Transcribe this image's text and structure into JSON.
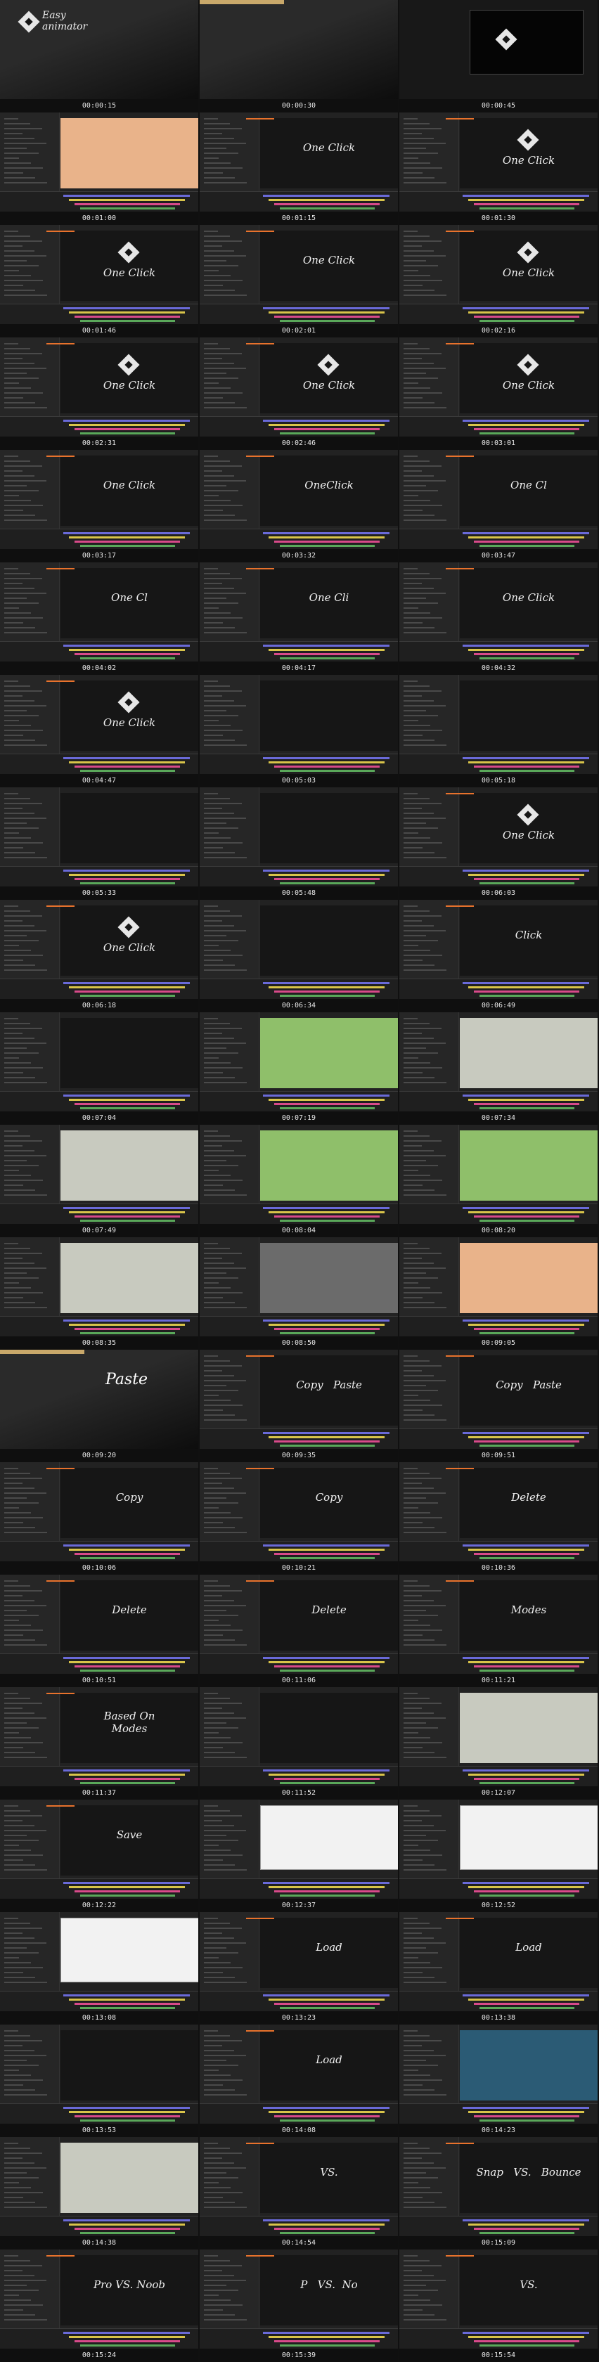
{
  "cells": [
    {
      "time": "00:00:15",
      "scene": "intro",
      "overlay": "Easy\nanimator"
    },
    {
      "time": "00:00:30",
      "scene": "intro3d",
      "overlay": ""
    },
    {
      "time": "00:00:45",
      "scene": "introsmall",
      "overlay": ""
    },
    {
      "time": "00:01:00",
      "scene": "room",
      "overlay": ""
    },
    {
      "time": "00:01:15",
      "scene": "ae",
      "overlay": "One Click"
    },
    {
      "time": "00:01:30",
      "scene": "ae-logo",
      "overlay": "One Click"
    },
    {
      "time": "00:01:46",
      "scene": "ae-logo",
      "overlay": "One Click"
    },
    {
      "time": "00:02:01",
      "scene": "ae",
      "overlay": "One Click"
    },
    {
      "time": "00:02:16",
      "scene": "ae-logo",
      "overlay": "One Click"
    },
    {
      "time": "00:02:31",
      "scene": "ae-logo",
      "overlay": "One Click"
    },
    {
      "time": "00:02:46",
      "scene": "ae-logo",
      "overlay": "One Click"
    },
    {
      "time": "00:03:01",
      "scene": "ae-logo",
      "overlay": "One Click"
    },
    {
      "time": "00:03:17",
      "scene": "ae",
      "overlay": "One Click"
    },
    {
      "time": "00:03:32",
      "scene": "ae",
      "overlay": "OneClick"
    },
    {
      "time": "00:03:47",
      "scene": "ae",
      "overlay": "One Cl"
    },
    {
      "time": "00:04:02",
      "scene": "ae",
      "overlay": "One Cl"
    },
    {
      "time": "00:04:17",
      "scene": "ae",
      "overlay": "One Cli"
    },
    {
      "time": "00:04:32",
      "scene": "ae",
      "overlay": "One Click"
    },
    {
      "time": "00:04:47",
      "scene": "ae-logo",
      "overlay": "One Click"
    },
    {
      "time": "00:05:03",
      "scene": "ae",
      "overlay": ""
    },
    {
      "time": "00:05:18",
      "scene": "ae",
      "overlay": ""
    },
    {
      "time": "00:05:33",
      "scene": "ae",
      "overlay": ""
    },
    {
      "time": "00:05:48",
      "scene": "ae",
      "overlay": ""
    },
    {
      "time": "00:06:03",
      "scene": "ae-logo",
      "overlay": "One Click"
    },
    {
      "time": "00:06:18",
      "scene": "ae-logo",
      "overlay": "One Click"
    },
    {
      "time": "00:06:34",
      "scene": "ae",
      "overlay": ""
    },
    {
      "time": "00:06:49",
      "scene": "ae",
      "overlay": "Click"
    },
    {
      "time": "00:07:04",
      "scene": "ae",
      "overlay": ""
    },
    {
      "time": "00:07:19",
      "scene": "city",
      "overlay": ""
    },
    {
      "time": "00:07:34",
      "scene": "map",
      "overlay": ""
    },
    {
      "time": "00:07:49",
      "scene": "map",
      "overlay": ""
    },
    {
      "time": "00:08:04",
      "scene": "city",
      "overlay": ""
    },
    {
      "time": "00:08:20",
      "scene": "city",
      "overlay": ""
    },
    {
      "time": "00:08:35",
      "scene": "map",
      "overlay": ""
    },
    {
      "time": "00:08:50",
      "scene": "street",
      "overlay": ""
    },
    {
      "time": "00:09:05",
      "scene": "room",
      "overlay": ""
    },
    {
      "time": "00:09:20",
      "scene": "intro3d",
      "overlay": "Paste"
    },
    {
      "time": "00:09:35",
      "scene": "ae",
      "overlay": "Copy   Paste"
    },
    {
      "time": "00:09:51",
      "scene": "ae",
      "overlay": "Copy   Paste"
    },
    {
      "time": "00:10:06",
      "scene": "ae",
      "overlay": "Copy"
    },
    {
      "time": "00:10:21",
      "scene": "ae",
      "overlay": "Copy"
    },
    {
      "time": "00:10:36",
      "scene": "ae",
      "overlay": "Delete"
    },
    {
      "time": "00:10:51",
      "scene": "ae",
      "overlay": "Delete"
    },
    {
      "time": "00:11:06",
      "scene": "ae",
      "overlay": "Delete"
    },
    {
      "time": "00:11:21",
      "scene": "ae",
      "overlay": "Modes"
    },
    {
      "time": "00:11:37",
      "scene": "ae",
      "overlay": "Based On\nModes"
    },
    {
      "time": "00:11:52",
      "scene": "ae",
      "overlay": ""
    },
    {
      "time": "00:12:07",
      "scene": "map",
      "overlay": ""
    },
    {
      "time": "00:12:22",
      "scene": "ae",
      "overlay": "Save"
    },
    {
      "time": "00:12:37",
      "scene": "dialog",
      "overlay": ""
    },
    {
      "time": "00:12:52",
      "scene": "dialog",
      "overlay": ""
    },
    {
      "time": "00:13:08",
      "scene": "dialog",
      "overlay": ""
    },
    {
      "time": "00:13:23",
      "scene": "ae",
      "overlay": "Load"
    },
    {
      "time": "00:13:38",
      "scene": "ae",
      "overlay": "Load"
    },
    {
      "time": "00:13:53",
      "scene": "ae",
      "overlay": ""
    },
    {
      "time": "00:14:08",
      "scene": "ae",
      "overlay": "Load"
    },
    {
      "time": "00:14:23",
      "scene": "globe",
      "overlay": ""
    },
    {
      "time": "00:14:38",
      "scene": "map",
      "overlay": ""
    },
    {
      "time": "00:14:54",
      "scene": "ae",
      "overlay": "VS."
    },
    {
      "time": "00:15:09",
      "scene": "ae",
      "overlay": "Snap   VS.   Bounce"
    },
    {
      "time": "00:15:24",
      "scene": "ae",
      "overlay": "Pro VS. Noob"
    },
    {
      "time": "00:15:39",
      "scene": "ae",
      "overlay": "P   VS.  No"
    },
    {
      "time": "00:15:54",
      "scene": "ae",
      "overlay": "VS."
    }
  ],
  "colors": {
    "orange": "#e8722c",
    "ui_bg": "#222222",
    "panel": "#262626",
    "viewport": "#161616",
    "map": "#c8cabf",
    "city_green": "#8fbf6a",
    "room": "#e9b38a",
    "globe": "#2b5b75"
  }
}
